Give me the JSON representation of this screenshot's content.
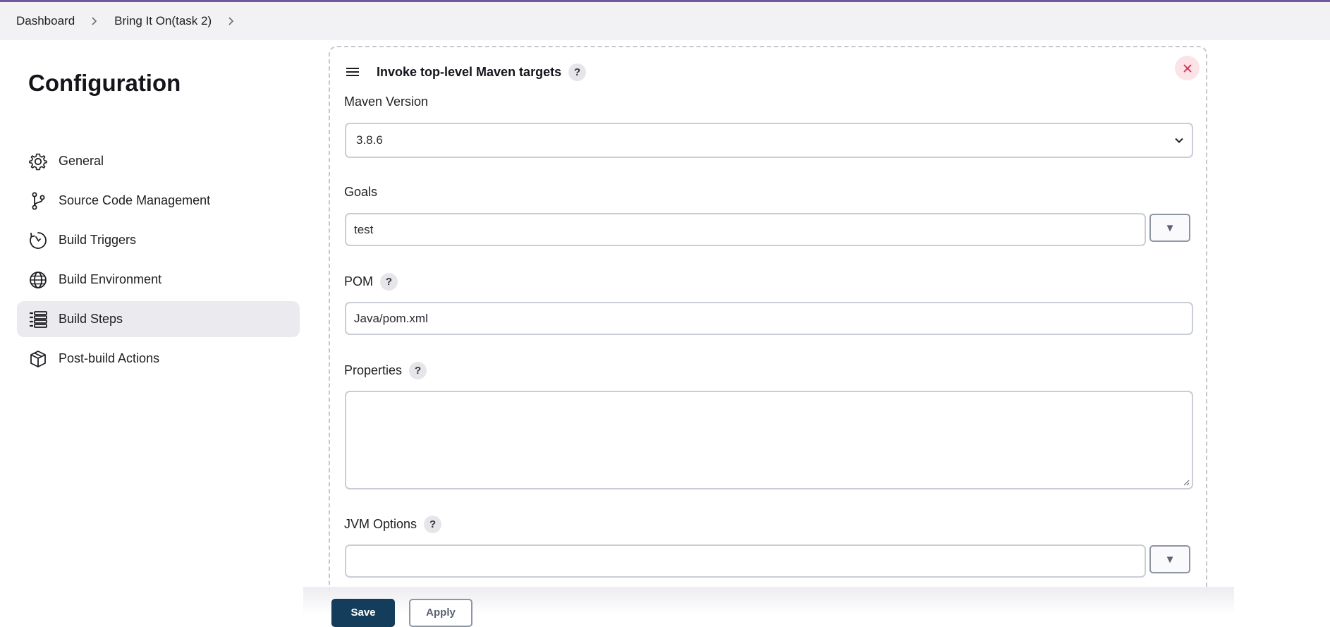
{
  "breadcrumb": {
    "items": [
      "Dashboard",
      "Bring It On(task 2)"
    ]
  },
  "page": {
    "title": "Configuration"
  },
  "sidebar": {
    "items": [
      {
        "label": "General",
        "icon": "gear-icon"
      },
      {
        "label": "Source Code Management",
        "icon": "branch-icon"
      },
      {
        "label": "Build Triggers",
        "icon": "clock-icon"
      },
      {
        "label": "Build Environment",
        "icon": "globe-icon"
      },
      {
        "label": "Build Steps",
        "icon": "list-icon",
        "active": true
      },
      {
        "label": "Post-build Actions",
        "icon": "package-icon"
      }
    ]
  },
  "step": {
    "title": "Invoke top-level Maven targets",
    "help": "?",
    "maven_version": {
      "label": "Maven Version",
      "value": "3.8.6"
    },
    "goals": {
      "label": "Goals",
      "value": "test"
    },
    "pom": {
      "label": "POM",
      "value": "Java/pom.xml"
    },
    "properties": {
      "label": "Properties",
      "value": ""
    },
    "jvm_options": {
      "label": "JVM Options",
      "value": ""
    }
  },
  "actions": {
    "save_label": "Save",
    "apply_label": "Apply"
  },
  "colors": {
    "accent_top": "#6f5a9c",
    "save_bg": "#143d5c",
    "active_nav": "#ebebef",
    "close_bg": "#fbe3e8",
    "close_x": "#d0304f"
  }
}
